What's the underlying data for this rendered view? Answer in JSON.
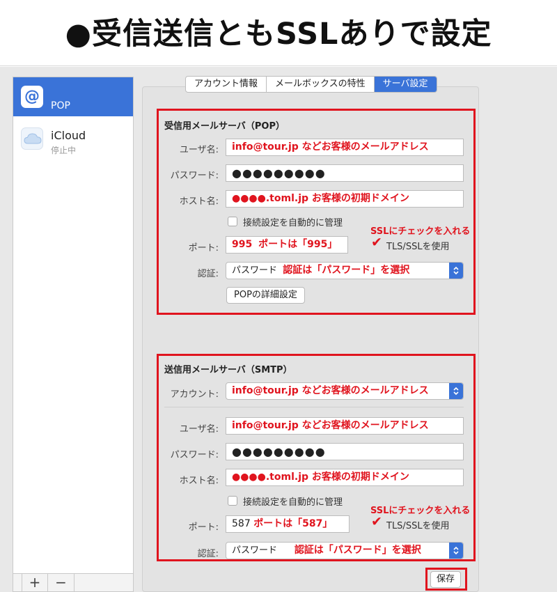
{
  "banner": {
    "title": "●受信送信ともSSLありで設定"
  },
  "sidebar": {
    "accounts": [
      {
        "name": "POP",
        "status": "",
        "icon": "at-icon"
      },
      {
        "name": "iCloud",
        "status": "停止中",
        "icon": "cloud-icon"
      }
    ],
    "add_label": "+",
    "remove_label": "−"
  },
  "tabs": [
    {
      "label": "アカウント情報",
      "active": false
    },
    {
      "label": "メールボックスの特性",
      "active": false
    },
    {
      "label": "サーバ設定",
      "active": true
    }
  ],
  "incoming": {
    "title": "受信用メールサーバ（POP）",
    "username_label": "ユーザ名:",
    "username_value": "info@tour.jp などお客様のメールアドレス",
    "password_label": "パスワード:",
    "password_value": "●●●●●●●●●",
    "host_label": "ホスト名:",
    "host_value": "●●●●.toml.jp  お客様の初期ドメイン",
    "auto_label": "接続設定を自動的に管理",
    "port_label": "ポート:",
    "port_number": "995",
    "port_note": "ポートは「995」",
    "ssl_note": "SSLにチェックを入れる",
    "ssl_label": "TLS/SSLを使用",
    "auth_label": "認証:",
    "auth_value": "パスワード",
    "auth_note": "認証は「パスワード」を選択",
    "details_button": "POPの詳細設定"
  },
  "outgoing": {
    "title": "送信用メールサーバ（SMTP）",
    "account_label": "アカウント:",
    "account_value": "info@tour.jp などお客様のメールアドレス",
    "username_label": "ユーザ名:",
    "username_value": "info@tour.jp などお客様のメールアドレス",
    "password_label": "パスワード:",
    "password_value": "●●●●●●●●●",
    "host_label": "ホスト名:",
    "host_value": "●●●●.toml.jp  お客様の初期ドメイン",
    "auto_label": "接続設定を自動的に管理",
    "port_label": "ポート:",
    "port_number": "587",
    "port_note": "ポートは「587」",
    "ssl_note": "SSLにチェックを入れる",
    "ssl_label": "TLS/SSLを使用",
    "auth_label": "認証:",
    "auth_value": "パスワード",
    "auth_note": "認証は「パスワード」を選択"
  },
  "save_button": "保存",
  "colors": {
    "accent": "#3a73d8",
    "annotation": "#e0141e"
  }
}
